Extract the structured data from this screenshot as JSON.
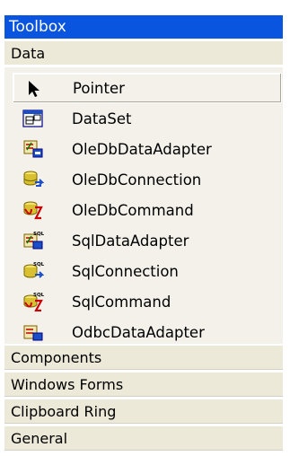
{
  "toolbox": {
    "title": "Toolbox",
    "active_section": "Data",
    "data_items": [
      {
        "label": "Pointer",
        "icon": "pointer-icon"
      },
      {
        "label": "DataSet",
        "icon": "dataset-icon"
      },
      {
        "label": "OleDbDataAdapter",
        "icon": "oledb-data-adapter-icon"
      },
      {
        "label": "OleDbConnection",
        "icon": "oledb-connection-icon"
      },
      {
        "label": "OleDbCommand",
        "icon": "oledb-command-icon"
      },
      {
        "label": "SqlDataAdapter",
        "icon": "sql-data-adapter-icon"
      },
      {
        "label": "SqlConnection",
        "icon": "sql-connection-icon"
      },
      {
        "label": "SqlCommand",
        "icon": "sql-command-icon"
      },
      {
        "label": "OdbcDataAdapter",
        "icon": "odbc-data-adapter-icon"
      }
    ],
    "sections": [
      {
        "label": "Components"
      },
      {
        "label": "Windows Forms"
      },
      {
        "label": "Clipboard Ring"
      },
      {
        "label": "General"
      }
    ]
  },
  "colors": {
    "title_bar": "#0a55df",
    "section_bg": "#ece9d8",
    "items_bg": "#f3f1ea"
  }
}
